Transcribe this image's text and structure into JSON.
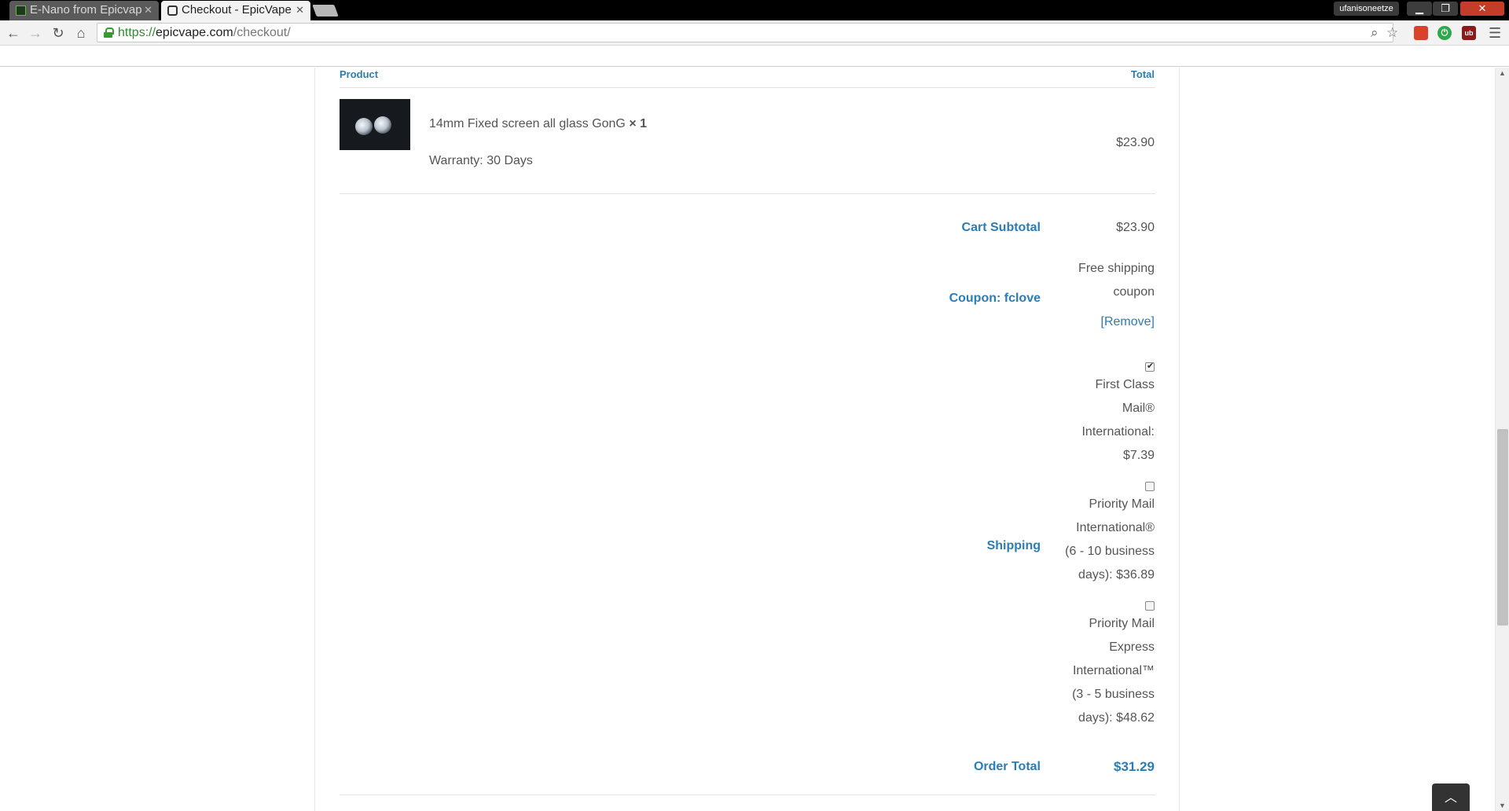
{
  "browser": {
    "tabs": [
      {
        "title": "E-Nano from Epicvap",
        "active": false
      },
      {
        "title": "Checkout - EpicVape",
        "active": true
      }
    ],
    "profile": "ufanisoneetze",
    "url": {
      "scheme": "https://",
      "host": "epicvape.com",
      "path": "/checkout/"
    },
    "ext_ub_label": "ub"
  },
  "order": {
    "headers": {
      "product": "Product",
      "total": "Total"
    },
    "item": {
      "name": "14mm Fixed screen all glass GonG",
      "qty": "× 1",
      "meta": "Warranty: 30 Days",
      "total": "$23.90"
    },
    "cart_subtotal": {
      "label": "Cart Subtotal",
      "value": "$23.90"
    },
    "coupon": {
      "label": "Coupon: fclove",
      "lines": [
        "Free shipping",
        "coupon"
      ],
      "remove": "[Remove]"
    },
    "shipping": {
      "label": "Shipping",
      "options": [
        {
          "lines": [
            "First Class",
            "Mail®",
            "International:",
            "$7.39"
          ],
          "checked": true
        },
        {
          "lines": [
            "Priority Mail",
            "International®",
            "(6 - 10 business",
            "days): $36.89"
          ],
          "checked": false
        },
        {
          "lines": [
            "Priority Mail",
            "Express",
            "International™",
            "(3 - 5 business",
            "days): $48.62"
          ],
          "checked": false
        }
      ]
    },
    "order_total": {
      "label": "Order Total",
      "value": "$31.29"
    }
  },
  "colors": {
    "accent": "#2b7db5",
    "text": "#555555"
  },
  "icons": {
    "back": "back-arrow-icon",
    "forward": "forward-arrow-icon",
    "reload": "reload-icon",
    "home": "home-icon",
    "lock": "lock-icon",
    "zoom": "zoom-icon",
    "star": "bookmark-star-icon",
    "menu": "menu-icon",
    "to_top": "chevron-up-icon"
  }
}
